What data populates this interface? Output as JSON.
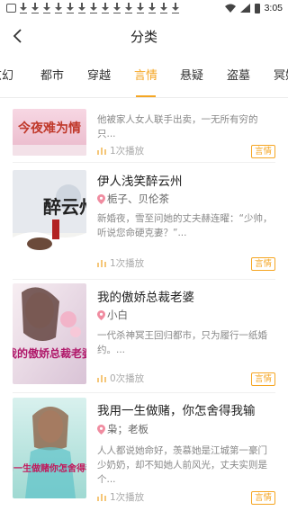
{
  "status_bar": {
    "time": "3:05"
  },
  "header": {
    "title": "分类"
  },
  "tabs": [
    {
      "label": "玄幻"
    },
    {
      "label": "都市"
    },
    {
      "label": "穿越"
    },
    {
      "label": "言情"
    },
    {
      "label": "悬疑"
    },
    {
      "label": "盗墓"
    },
    {
      "label": "冥婚"
    }
  ],
  "active_tab": "言情",
  "books": [
    {
      "title": "",
      "author": "",
      "description": "他被家人女人联手出卖，一无所有穷的只...",
      "plays": "1次播放",
      "tag": "言情",
      "cover_title": "今夜难为情"
    },
    {
      "title": "伊人浅笑醉云州",
      "author": "栀子、贝伦茶",
      "description": "新婚夜，雪至问她的丈夫赫连曜：“少帅，听说您命硬克妻？”...",
      "plays": "1次播放",
      "tag": "言情",
      "cover_title": "醉云州"
    },
    {
      "title": "我的傲娇总裁老婆",
      "author": "小白",
      "description": "一代杀神冥王回归都市，只为履行一纸婚约。...",
      "plays": "0次播放",
      "tag": "言情",
      "cover_title": "我的傲娇总裁老婆"
    },
    {
      "title": "我用一生做赌，你怎舍得我输",
      "author": "枭；老板",
      "description": "人人都说她命好，羡慕她是江城第一豪门少奶奶，却不知她人前风光，丈夫实则是个...",
      "plays": "1次播放",
      "tag": "言情",
      "cover_title": "我用一生做赌你怎舍得我输"
    }
  ],
  "colors": {
    "accent": "#f5a623"
  },
  "icons": [
    "back-arrow-icon",
    "location-pin-icon",
    "bar-chart-icon",
    "wifi-icon",
    "signal-icon",
    "battery-icon",
    "download-icon"
  ]
}
